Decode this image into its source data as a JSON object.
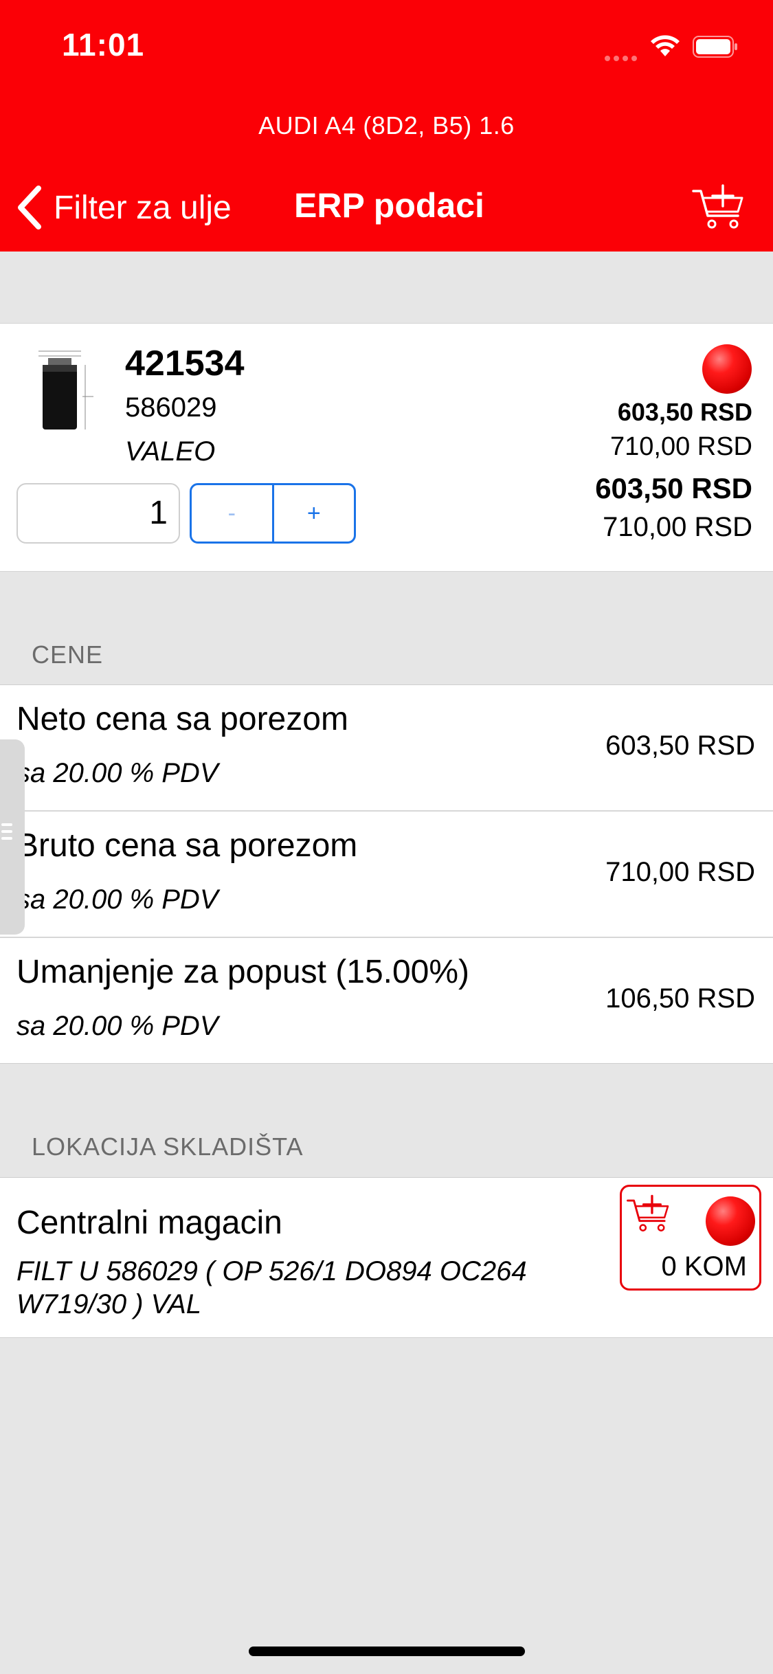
{
  "status_bar": {
    "time": "11:01"
  },
  "header": {
    "vehicle": "AUDI A4 (8D2, B5) 1.6",
    "back_label": "Filter za ulje",
    "title": "ERP podaci",
    "cart_icon": "cart-add-icon",
    "color": "#fb0006"
  },
  "product": {
    "article_number": "421534",
    "code": "586029",
    "brand": "VALEO",
    "status": "unavailable",
    "prices": [
      "603,50 RSD",
      "710,00 RSD",
      "603,50 RSD",
      "710,00 RSD"
    ],
    "quantity": "1",
    "minus_label": "-",
    "plus_label": "+"
  },
  "prices_section": {
    "header": "CENE",
    "rows": [
      {
        "title": "Neto cena sa porezom",
        "subtitle": "sa 20.00 % PDV",
        "value": "603,50 RSD"
      },
      {
        "title": "Bruto cena sa porezom",
        "subtitle": "sa 20.00 % PDV",
        "value": "710,00 RSD"
      },
      {
        "title": "Umanjenje za popust (15.00%)",
        "subtitle": "sa 20.00 % PDV",
        "value": "106,50 RSD"
      }
    ]
  },
  "warehouse_section": {
    "header": "LOKACIJA SKLADIŠTA",
    "name": "Centralni magacin",
    "description": "FILT U 586029 ( OP 526/1 DO894 OC264 W719/30 ) VAL",
    "stock": "0 KOM",
    "status": "unavailable"
  }
}
